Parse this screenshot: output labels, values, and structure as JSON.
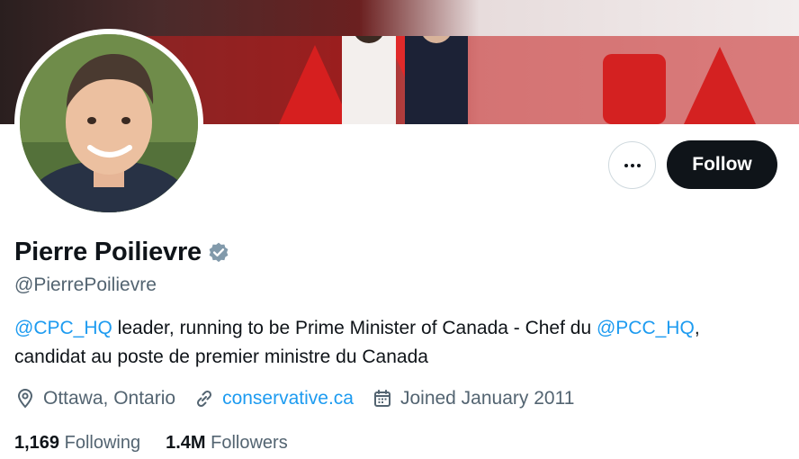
{
  "profile": {
    "display_name": "Pierre Poilievre",
    "handle": "@PierrePoilievre",
    "verified_icon": "verified-badge-icon",
    "bio": {
      "mention_1": "@CPC_HQ",
      "text_1": " leader, running to be Prime Minister of Canada - Chef du ",
      "mention_2": "@PCC_HQ",
      "text_2": ",",
      "line_2": "candidat au poste de premier ministre du Canada"
    },
    "location": "Ottawa, Ontario",
    "website": "conservative.ca",
    "joined": "Joined January 2011",
    "following_count": "1,169",
    "following_label": "Following",
    "followers_count": "1.4M",
    "followers_label": "Followers"
  },
  "actions": {
    "follow_label": "Follow",
    "more_icon": "more-options-icon"
  },
  "colors": {
    "accent": "#1d9bf0",
    "text_primary": "#0f1419",
    "text_secondary": "#536471",
    "follow_bg": "#0f1419",
    "verified": "#829aab"
  }
}
